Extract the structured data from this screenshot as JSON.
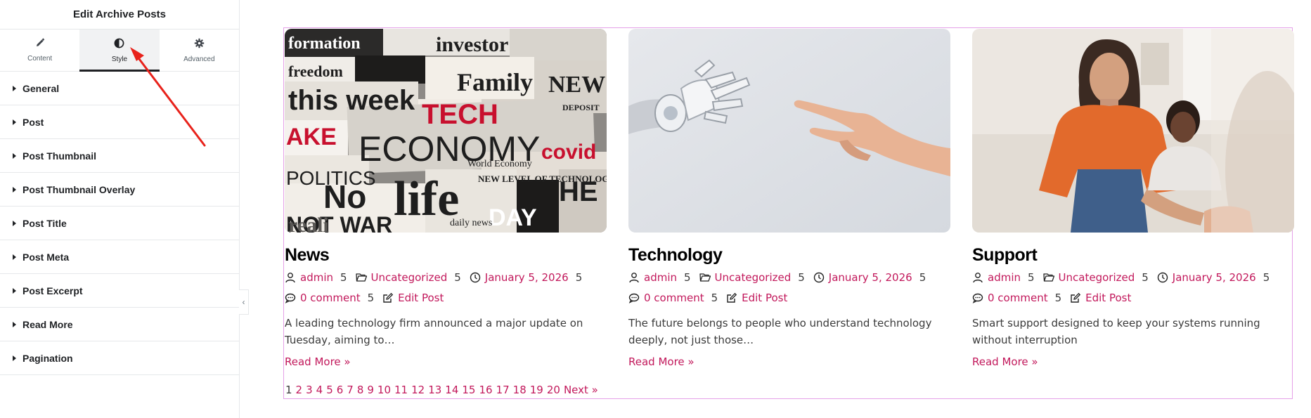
{
  "panel": {
    "title": "Edit Archive Posts",
    "tabs": [
      {
        "label": "Content",
        "icon": "pencil-icon"
      },
      {
        "label": "Style",
        "icon": "contrast-icon"
      },
      {
        "label": "Advanced",
        "icon": "gear-icon"
      }
    ],
    "active_tab": "Style",
    "sections": [
      {
        "label": "General"
      },
      {
        "label": "Post"
      },
      {
        "label": "Post Thumbnail"
      },
      {
        "label": "Post Thumbnail Overlay"
      },
      {
        "label": "Post Title"
      },
      {
        "label": "Post Meta"
      },
      {
        "label": "Post Excerpt"
      },
      {
        "label": "Read More"
      },
      {
        "label": "Pagination"
      }
    ],
    "collapse_icon": "‹"
  },
  "annotation": {
    "color": "#e8221b"
  },
  "posts": [
    {
      "title": "News",
      "author": "admin",
      "author_count": "5",
      "category": "Uncategorized",
      "category_count": "5",
      "date": "January 5, 2026",
      "date_count": "5",
      "comments": "0 comment",
      "comments_count": "5",
      "edit": "Edit Post",
      "excerpt": "A leading technology firm announced a major update on Tuesday, aiming to…",
      "read_more": "Read More »",
      "image": "newspaper-collage"
    },
    {
      "title": "Technology",
      "author": "admin",
      "author_count": "5",
      "category": "Uncategorized",
      "category_count": "5",
      "date": "January 5, 2026",
      "date_count": "5",
      "comments": "0 comment",
      "comments_count": "5",
      "edit": "Edit Post",
      "excerpt": "The future belongs to people who understand technology deeply, not just those…",
      "read_more": "Read More »",
      "image": "robot-and-human-hands"
    },
    {
      "title": "Support",
      "author": "admin",
      "author_count": "5",
      "category": "Uncategorized",
      "category_count": "5",
      "date": "January 5, 2026",
      "date_count": "5",
      "comments": "0 comment",
      "comments_count": "5",
      "edit": "Edit Post",
      "excerpt": "Smart support designed to keep your systems running without interruption",
      "read_more": "Read More »",
      "image": "people-handshake-office"
    }
  ],
  "collage_words": [
    "formation",
    "investor",
    "freedom",
    "Family",
    "NEW",
    "this week",
    "DEPOSIT",
    "TECH",
    "AKE",
    "ECONOMY",
    "POLITICS",
    "World Economy",
    "covid",
    "No",
    "life",
    "NEW LEVEL OF TECHNOLOGY",
    "NOT WAR",
    "HE",
    "DAY",
    "daily news",
    "reali"
  ],
  "pagination": {
    "pages": [
      "1",
      "2",
      "3",
      "4",
      "5",
      "6",
      "7",
      "8",
      "9",
      "10",
      "11",
      "12",
      "13",
      "14",
      "15",
      "16",
      "17",
      "18",
      "19",
      "20"
    ],
    "current": "1",
    "next": "Next »"
  },
  "colors": {
    "link": "#c2185b",
    "preview_border": "#e5a0e8",
    "active_tab_bg": "#f1f2f3"
  }
}
